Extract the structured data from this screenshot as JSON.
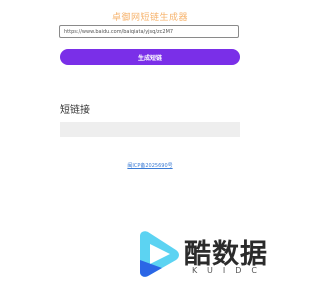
{
  "header": {
    "title": "卓御网短链生成器"
  },
  "form": {
    "url_value": "https://www.baidu.com/baiqiata/yjsq/zc2M7",
    "generate_button": "生成短链"
  },
  "result": {
    "label": "短链接",
    "value": ""
  },
  "footer": {
    "icp_link": "闽ICP备2025690号"
  },
  "watermark": {
    "brand_cn": "酷数据",
    "brand_en": "KUIDC",
    "colors": {
      "cyan": "#5cd3f2",
      "blue": "#2b66e6"
    }
  }
}
